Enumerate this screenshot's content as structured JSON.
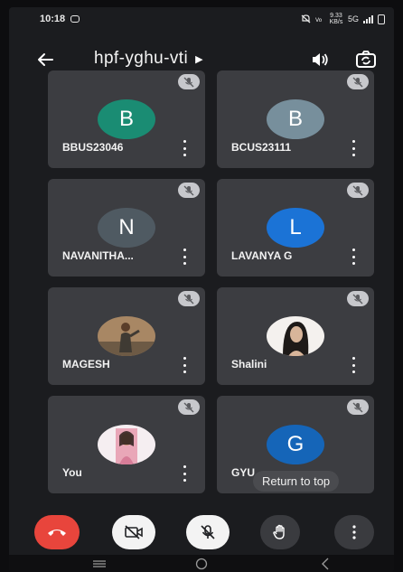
{
  "status_bar": {
    "time": "10:18",
    "network_speed": "9.33 KB/s",
    "network_type": "5G"
  },
  "header": {
    "meeting_code": "hpf-yghu-vti",
    "icons": [
      "back-arrow-icon",
      "speaker-icon",
      "switch-camera-icon"
    ]
  },
  "participants": [
    {
      "name": "BBUS23046",
      "initial": "B",
      "avatar_color": "#1a8c73",
      "muted": true
    },
    {
      "name": "BCUS23111",
      "initial": "B",
      "avatar_color": "#778f9c",
      "muted": true
    },
    {
      "name": "NAVANITHA...",
      "initial": "N",
      "avatar_color": "#4f5a62",
      "muted": true
    },
    {
      "name": "LAVANYA G",
      "initial": "L",
      "avatar_color": "#1b73d6",
      "muted": true
    },
    {
      "name": "MAGESH",
      "initial": "",
      "avatar_color": "#8a6a4a",
      "muted": true,
      "photo": true
    },
    {
      "name": "Shalini",
      "initial": "",
      "avatar_color": "#efeae6",
      "muted": true,
      "photo": true
    },
    {
      "name": "You",
      "initial": "",
      "avatar_color": "#f2e8ee",
      "muted": true,
      "photo": true
    },
    {
      "name": "GYU",
      "initial": "G",
      "avatar_color": "#1565b8",
      "muted": true
    }
  ],
  "return_to_top": "Return to top",
  "controls": {
    "icons": [
      "hang-up-icon",
      "camera-off-icon",
      "mic-off-icon",
      "raise-hand-icon",
      "more-options-icon"
    ],
    "hangup_color": "#e8453c"
  }
}
